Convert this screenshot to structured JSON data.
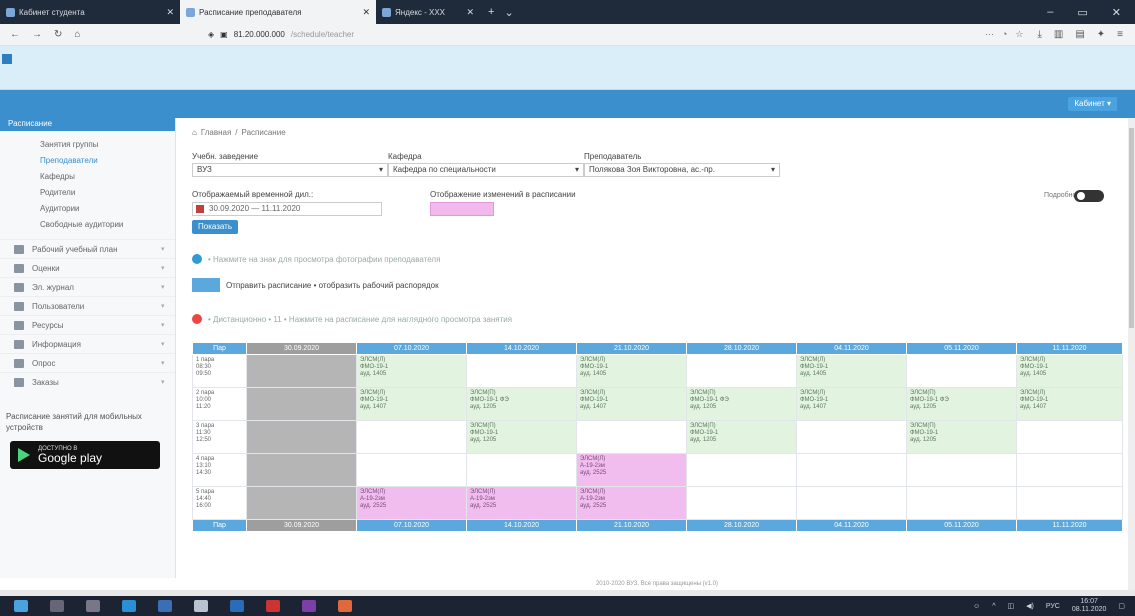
{
  "browser": {
    "tabs": [
      {
        "title": "Кабинет студента"
      },
      {
        "title": "Расписание преподавателя"
      },
      {
        "title": "Яндекс - ХХХ"
      }
    ],
    "url": "81.20.000.000",
    "url_path": "/schedule/teacher"
  },
  "header": {
    "user_button": "Кабинет ▾"
  },
  "sidebar": {
    "section": "Расписание",
    "sub_items": [
      {
        "label": "Занятия группы"
      },
      {
        "label": "Преподаватели",
        "active": true
      },
      {
        "label": "Кафедры"
      },
      {
        "label": "Родители"
      },
      {
        "label": "Аудитории"
      },
      {
        "label": "Свободные аудитории"
      }
    ],
    "main_items": [
      {
        "label": "Рабочий учебный план"
      },
      {
        "label": "Оценки"
      },
      {
        "label": "Эл. журнал"
      },
      {
        "label": "Пользователи"
      },
      {
        "label": "Ресурсы"
      },
      {
        "label": "Информация"
      },
      {
        "label": "Опрос"
      },
      {
        "label": "Заказы"
      }
    ],
    "promo_text": "Расписание занятий для мобильных устройств",
    "gplay_small": "ДОСТУПНО В",
    "gplay_big": "Google play"
  },
  "breadcrumb": {
    "home": "Главная",
    "current": "Расписание"
  },
  "filters": {
    "year_label": "Учебн. заведение",
    "year_value": "ВУЗ",
    "dept_label": "Кафедра",
    "dept_value": "Кафедра по специальности",
    "teacher_label": "Преподаватель",
    "teacher_value": "Полякова Зоя Викторовна, ас.-пр.",
    "period_label": "Отображаемый временной дил.:",
    "period_value": "30.09.2020 — 11.11.2020",
    "color_label": "Отображение изменений в расписании",
    "show_button": "Показать",
    "toggle_label": "Подробно"
  },
  "info": {
    "line1": "• Нажмите на знак для просмотра фотографии преподавателя",
    "send_text": "Отправить расписание • отобразить рабочий распорядок",
    "line2": "• Дистанционно • 11 • Нажмите на расписание для наглядного просмотра занятия"
  },
  "schedule": {
    "corner": "Пар",
    "days": [
      "30.09.2020",
      "07.10.2020",
      "14.10.2020",
      "21.10.2020",
      "28.10.2020",
      "04.11.2020",
      "05.11.2020",
      "11.11.2020"
    ],
    "rows": [
      {
        "pair": [
          "1 пара",
          "08:30",
          "09:50"
        ],
        "cells": [
          "grey",
          {
            "t": "green",
            "l": [
              "ЭЛСМ(Л)",
              "ФМО-19-1",
              "ауд. 1405"
            ]
          },
          "",
          {
            "t": "green",
            "l": [
              "ЭЛСМ(Л)",
              "ФМО-19-1",
              "ауд. 1405"
            ]
          },
          "",
          {
            "t": "green",
            "l": [
              "ЭЛСМ(Л)",
              "ФМО-19-1",
              "ауд. 1405"
            ]
          },
          "",
          {
            "t": "green",
            "l": [
              "ЭЛСМ(Л)",
              "ФМО-19-1",
              "ауд. 1405"
            ]
          }
        ]
      },
      {
        "pair": [
          "2 пара",
          "10:00",
          "11:20"
        ],
        "cells": [
          "grey",
          {
            "t": "green",
            "l": [
              "ЭЛСМ(Л)",
              "ФМО-19-1",
              "ауд. 1407"
            ]
          },
          {
            "t": "green",
            "l": [
              "ЭЛСМ(П)",
              "ФМО-19-1 ФЭ",
              "ауд. 1205"
            ]
          },
          {
            "t": "green",
            "l": [
              "ЭЛСМ(Л)",
              "ФМО-19-1",
              "ауд. 1407"
            ]
          },
          {
            "t": "green",
            "l": [
              "ЭЛСМ(П)",
              "ФМО-19-1 ФЭ",
              "ауд. 1205"
            ]
          },
          {
            "t": "green",
            "l": [
              "ЭЛСМ(Л)",
              "ФМО-19-1",
              "ауд. 1407"
            ]
          },
          {
            "t": "green",
            "l": [
              "ЭЛСМ(П)",
              "ФМО-19-1 ФЭ",
              "ауд. 1205"
            ]
          },
          {
            "t": "green",
            "l": [
              "ЭЛСМ(Л)",
              "ФМО-19-1",
              "ауд. 1407"
            ]
          }
        ]
      },
      {
        "pair": [
          "3 пара",
          "11:30",
          "12:50"
        ],
        "cells": [
          "grey",
          "",
          {
            "t": "green",
            "l": [
              "ЭЛСМ(П)",
              "ФМО-19-1",
              "ауд. 1205"
            ]
          },
          "",
          {
            "t": "green",
            "l": [
              "ЭЛСМ(П)",
              "ФМО-19-1",
              "ауд. 1205"
            ]
          },
          "",
          {
            "t": "green",
            "l": [
              "ЭЛСМ(П)",
              "ФМО-19-1",
              "ауд. 1205"
            ]
          },
          ""
        ]
      },
      {
        "pair": [
          "4 пара",
          "13:10",
          "14:30"
        ],
        "cells": [
          "grey",
          "",
          "",
          {
            "t": "pink",
            "l": [
              "ЭЛСМ(Л)",
              "А-19-2зм",
              "ауд. 2525"
            ]
          },
          "",
          "",
          "",
          ""
        ]
      },
      {
        "pair": [
          "5 пара",
          "14:40",
          "16:00"
        ],
        "cells": [
          "grey",
          {
            "t": "pink",
            "l": [
              "ЭЛСМ(Л)",
              "А-19-2зм",
              "ауд. 2525"
            ]
          },
          {
            "t": "pink",
            "l": [
              "ЭЛСМ(Л)",
              "А-19-2зм",
              "ауд. 2525"
            ]
          },
          {
            "t": "pink",
            "l": [
              "ЭЛСМ(Л)",
              "А-19-2зм",
              "ауд. 2525"
            ]
          },
          "",
          "",
          "",
          ""
        ]
      }
    ]
  },
  "footer": "2010-2020 ВУЗ. Все права защищены (v1.0)",
  "taskbar": {
    "clock": "16:07",
    "date": "08.11.2020",
    "lang": "РУС"
  }
}
